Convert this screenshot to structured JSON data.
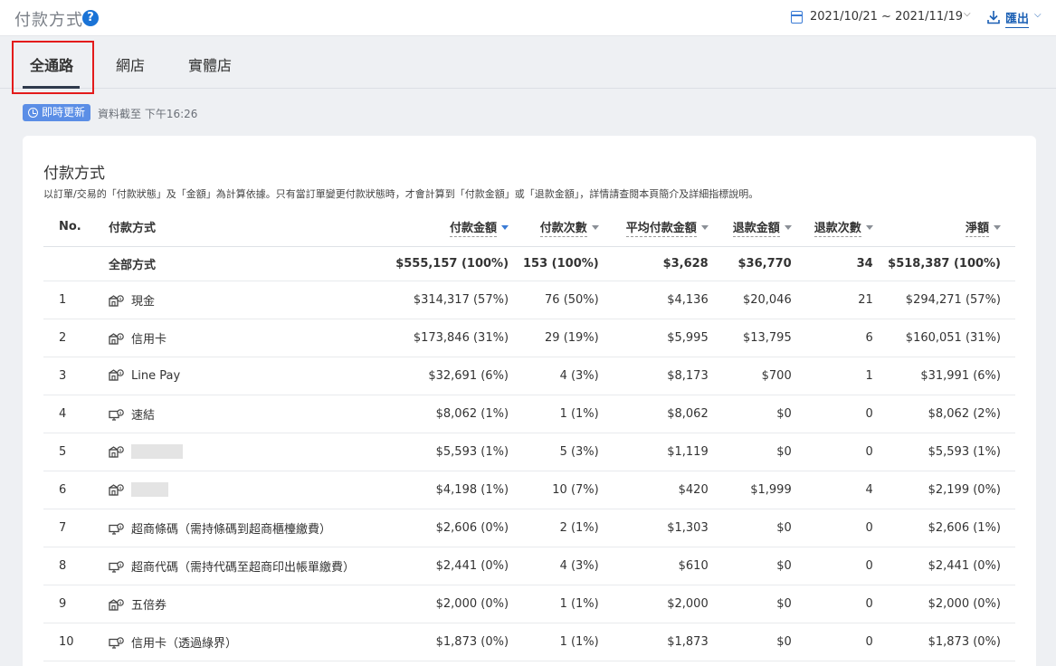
{
  "header": {
    "title": "付款方式",
    "help_icon": "?",
    "date_range": "2021/10/21 ~ 2021/11/19",
    "export_label": "匯出"
  },
  "tabs": [
    {
      "label": "全通路",
      "active": true
    },
    {
      "label": "網店",
      "active": false
    },
    {
      "label": "實體店",
      "active": false
    }
  ],
  "realtime": {
    "badge_label": "即時更新",
    "update_text": "資料截至 下午16:26"
  },
  "card": {
    "title": "付款方式",
    "description": "以訂單/交易的「付款狀態」及「金額」為計算依據。只有當訂單變更付款狀態時，才會計算到「付款金額」或「退款金額」，詳情請查閱本頁簡介及詳細指標說明。"
  },
  "table": {
    "headers": {
      "no": "No.",
      "method": "付款方式",
      "paid_amount": "付款金額",
      "paid_count": "付款次數",
      "avg_amount": "平均付款金額",
      "refund_amount": "退款金額",
      "refund_count": "退款次數",
      "net": "淨額"
    },
    "total": {
      "method": "全部方式",
      "paid_amount": "$555,157 (100%)",
      "paid_count": "153 (100%)",
      "avg_amount": "$3,628",
      "refund_amount": "$36,770",
      "refund_count": "34",
      "net": "$518,387 (100%)"
    },
    "rows": [
      {
        "no": "1",
        "icon": "store-icon",
        "method": "現金",
        "paid_amount": "$314,317 (57%)",
        "paid_count": "76 (50%)",
        "avg_amount": "$4,136",
        "refund_amount": "$20,046",
        "refund_count": "21",
        "net": "$294,271 (57%)"
      },
      {
        "no": "2",
        "icon": "store-icon",
        "method": "信用卡",
        "paid_amount": "$173,846 (31%)",
        "paid_count": "29 (19%)",
        "avg_amount": "$5,995",
        "refund_amount": "$13,795",
        "refund_count": "6",
        "net": "$160,051 (31%)"
      },
      {
        "no": "3",
        "icon": "store-icon",
        "method": "Line Pay",
        "paid_amount": "$32,691 (6%)",
        "paid_count": "4 (3%)",
        "avg_amount": "$8,173",
        "refund_amount": "$700",
        "refund_count": "1",
        "net": "$31,991 (6%)"
      },
      {
        "no": "4",
        "icon": "online-icon",
        "method": "速結",
        "paid_amount": "$8,062 (1%)",
        "paid_count": "1 (1%)",
        "avg_amount": "$8,062",
        "refund_amount": "$0",
        "refund_count": "0",
        "net": "$8,062 (2%)"
      },
      {
        "no": "5",
        "icon": "store-icon",
        "method": "",
        "paid_amount": "$5,593 (1%)",
        "paid_count": "5 (3%)",
        "avg_amount": "$1,119",
        "refund_amount": "$0",
        "refund_count": "0",
        "net": "$5,593 (1%)"
      },
      {
        "no": "6",
        "icon": "store-icon",
        "method": "",
        "paid_amount": "$4,198 (1%)",
        "paid_count": "10 (7%)",
        "avg_amount": "$420",
        "refund_amount": "$1,999",
        "refund_count": "4",
        "net": "$2,199 (0%)"
      },
      {
        "no": "7",
        "icon": "online-icon",
        "method": "超商條碼（需持條碼到超商櫃檯繳費）",
        "paid_amount": "$2,606 (0%)",
        "paid_count": "2 (1%)",
        "avg_amount": "$1,303",
        "refund_amount": "$0",
        "refund_count": "0",
        "net": "$2,606 (1%)"
      },
      {
        "no": "8",
        "icon": "online-icon",
        "method": "超商代碼（需持代碼至超商印出帳單繳費）",
        "paid_amount": "$2,441 (0%)",
        "paid_count": "4 (3%)",
        "avg_amount": "$610",
        "refund_amount": "$0",
        "refund_count": "0",
        "net": "$2,441 (0%)"
      },
      {
        "no": "9",
        "icon": "store-icon",
        "method": "五倍券",
        "paid_amount": "$2,000 (0%)",
        "paid_count": "1 (1%)",
        "avg_amount": "$2,000",
        "refund_amount": "$0",
        "refund_count": "0",
        "net": "$2,000 (0%)"
      },
      {
        "no": "10",
        "icon": "online-icon",
        "method": "信用卡（透過綠界）",
        "paid_amount": "$1,873 (0%)",
        "paid_count": "1 (1%)",
        "avg_amount": "$1,873",
        "refund_amount": "$0",
        "refund_count": "0",
        "net": "$1,873 (0%)"
      }
    ]
  },
  "colors": {
    "accent": "#3a7bd5",
    "badge": "#5b8ee6",
    "highlight": "#e31b1b"
  }
}
